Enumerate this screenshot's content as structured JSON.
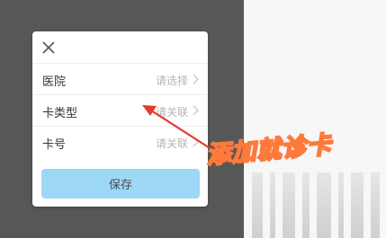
{
  "dialog": {
    "rows": [
      {
        "label": "医院",
        "value": "请选择"
      },
      {
        "label": "卡类型",
        "value": "请关联"
      },
      {
        "label": "卡号",
        "value": "请关联"
      }
    ],
    "save_label": "保存"
  },
  "annotation": {
    "text": "添加就诊卡"
  },
  "colors": {
    "backdrop": "#575757",
    "save_button": "#9ed8f7",
    "arrow": "#e33b2d",
    "annotation_outline": "#ff7a3a"
  },
  "icons": [
    "close-icon",
    "chevron-right-icon",
    "arrow-annotation-icon"
  ]
}
